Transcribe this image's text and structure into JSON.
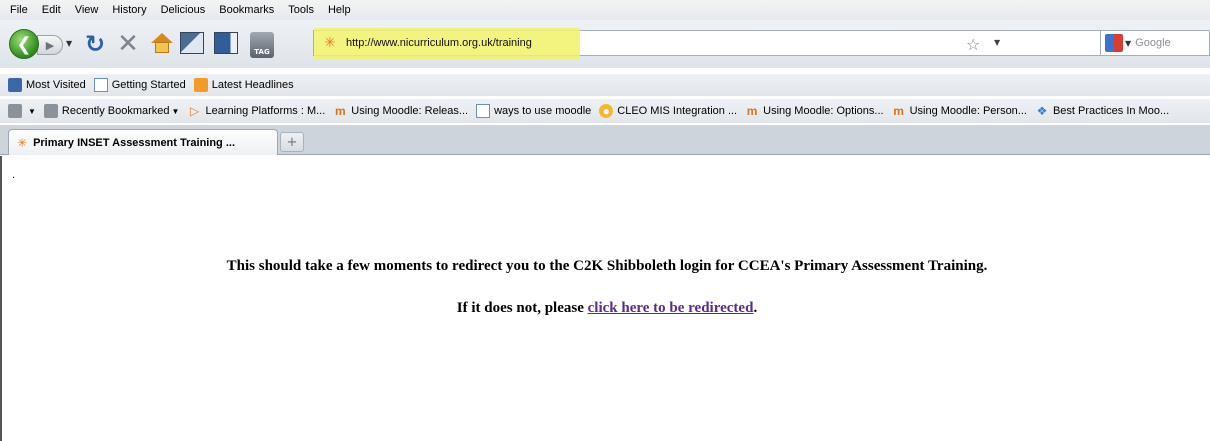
{
  "menubar": {
    "items": [
      "File",
      "Edit",
      "View",
      "History",
      "Delicious",
      "Bookmarks",
      "Tools",
      "Help"
    ]
  },
  "navbar": {
    "tag_icon_label": "TAG",
    "url": "http://www.nicurriculum.org.uk/training",
    "search_placeholder": "Google"
  },
  "bookmarks_toolbar": {
    "items": [
      "Most Visited",
      "Getting Started",
      "Latest Headlines"
    ]
  },
  "delicious_toolbar": {
    "items": [
      "Recently Bookmarked",
      "Learning Platforms : M...",
      "Using Moodle: Releas...",
      "ways to use moodle",
      "CLEO MIS Integration ...",
      "Using Moodle: Options...",
      "Using Moodle: Person...",
      "Best Practices In Moo..."
    ]
  },
  "tabs": [
    {
      "label": "Primary INSET Assessment Training ..."
    }
  ],
  "content": {
    "dot": ".",
    "line1": "This should take a few moments to redirect you to the C2K Shibboleth login for CCEA's Primary Assessment Training.",
    "line2_prefix": "If it does not, please ",
    "link_text": "click here to be redirected",
    "line2_suffix": "."
  },
  "colors": {
    "url_highlight": "#f1f26a",
    "visited_link": "#5a2a8c",
    "back_button": "#2e8a1a"
  }
}
